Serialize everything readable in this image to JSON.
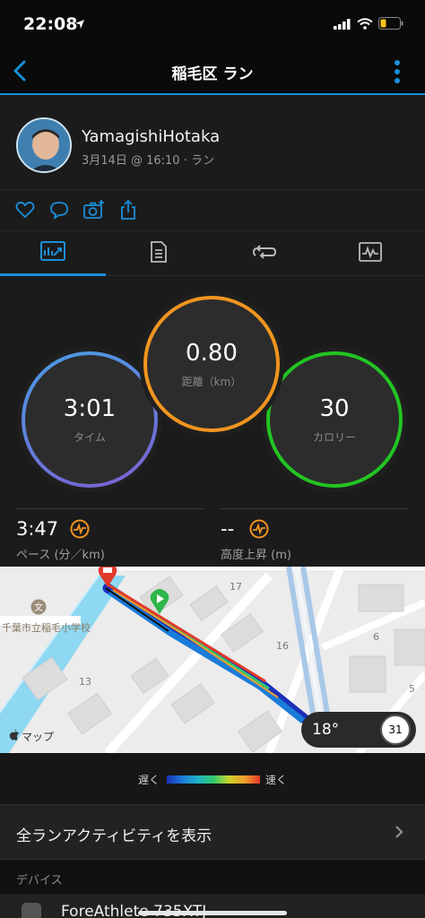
{
  "status_bar": {
    "time": "22:08",
    "icons": [
      "location-arrow-icon",
      "signal-icon",
      "wifi-icon",
      "battery-icon"
    ]
  },
  "nav": {
    "title": "稲毛区 ラン",
    "back_icon": "chevron-left-icon",
    "more_icon": "vertical-dots-icon",
    "accent_color": "#1a8fd9"
  },
  "profile": {
    "name": "YamagishiHotaka",
    "meta": "3月14日 @ 16:10 · ラン"
  },
  "actions": [
    "heart-icon",
    "comment-icon",
    "camera-add-icon",
    "share-icon"
  ],
  "tabs": [
    {
      "icon": "stats-chart-icon",
      "active": true
    },
    {
      "icon": "document-icon",
      "active": false
    },
    {
      "icon": "laps-icon",
      "active": false
    },
    {
      "icon": "graph-icon",
      "active": false
    }
  ],
  "stats": {
    "time": {
      "value": "3:01",
      "label": "タイム",
      "color": "#5a6fd8"
    },
    "distance": {
      "value": "0.80",
      "label": "距離（km）",
      "color": "#f2951f"
    },
    "calories": {
      "value": "30",
      "label": "カロリー",
      "color": "#22c422"
    }
  },
  "substats": {
    "pace": {
      "value": "3:47",
      "label": "ペース (分／km)"
    },
    "elevation": {
      "value": "--",
      "label": "高度上昇 (m)"
    }
  },
  "map": {
    "school_label": "千葉市立稲毛小学校",
    "attribution": "マップ",
    "block_numbers": [
      "17",
      "16",
      "13",
      "6",
      "5"
    ],
    "weather_temp": "18°",
    "weather_dial": "31"
  },
  "legend": {
    "slow": "遅く",
    "fast": "速く"
  },
  "link": {
    "label": "全ランアクティビティを表示"
  },
  "devices": {
    "title": "デバイス",
    "device_name": "ForeAthlete 735XTJ"
  }
}
